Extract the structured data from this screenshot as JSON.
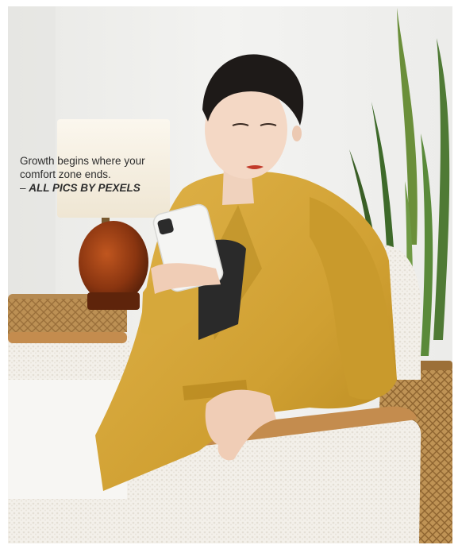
{
  "caption": {
    "line1": "Growth begins where your",
    "line2": "comfort zone ends.",
    "credit_prefix": "– ",
    "credit": "ALL PICS BY PEXELS"
  },
  "photo": {
    "subject": "woman in mustard blazer seated in a white boucle armchair looking at a smartphone",
    "colors": {
      "wall": "#eeeeec",
      "blazer": "#d2a234",
      "chair": "#f2efe9",
      "lamp_base": "#8a3510",
      "plant": "#4f7a35",
      "basket": "#b98a4a"
    }
  }
}
